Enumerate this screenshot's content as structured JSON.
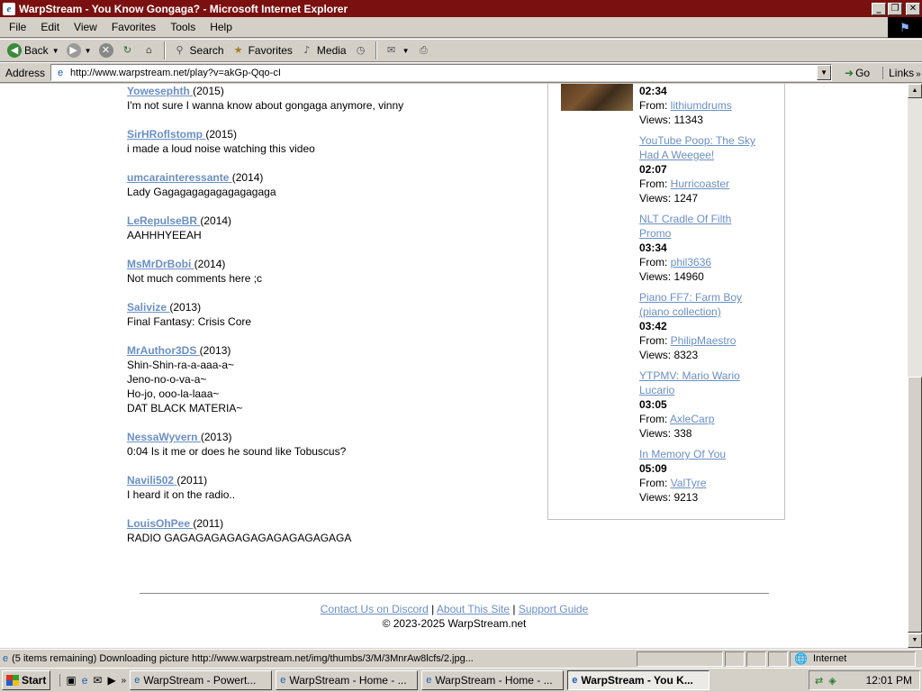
{
  "window": {
    "title": "WarpStream - You Know Gongaga? - Microsoft Internet Explorer",
    "buttons": {
      "minimize": "_",
      "maximize": "❐",
      "close": "✕"
    }
  },
  "menu": [
    "File",
    "Edit",
    "View",
    "Favorites",
    "Tools",
    "Help"
  ],
  "toolbar": {
    "back": "Back",
    "search": "Search",
    "favorites": "Favorites",
    "media": "Media"
  },
  "address": {
    "label": "Address",
    "url": "http://www.warpstream.net/play?v=akGp-Qqo-cI",
    "go": "Go",
    "links": "Links"
  },
  "comments": [
    {
      "author": "Yowesephth ",
      "year": "(2015)",
      "lines": [
        "I'm not sure I wanna know about gongaga anymore, vinny"
      ]
    },
    {
      "author": "SirHRoflstomp ",
      "year": "(2015)",
      "lines": [
        "i made a loud noise watching this video"
      ]
    },
    {
      "author": "umcarainteressante ",
      "year": "(2014)",
      "lines": [
        "Lady Gagagagagagagagagaga"
      ]
    },
    {
      "author": "LeRepulseBR ",
      "year": "(2014)",
      "lines": [
        "AAHHHYEEAH"
      ]
    },
    {
      "author": "MsMrDrBobi ",
      "year": "(2014)",
      "lines": [
        "Not much comments here ;c"
      ]
    },
    {
      "author": "Salivize ",
      "year": "(2013)",
      "lines": [
        "Final Fantasy: Crisis Core"
      ]
    },
    {
      "author": "MrAuthor3DS ",
      "year": "(2013)",
      "lines": [
        "Shin-Shin-ra-a-aaa-a~",
        "Jeno-no-o-va-a~",
        "Ho-jo, ooo-la-laaa~",
        "DAT BLACK MATERIA~"
      ]
    },
    {
      "author": "NessaWyvern ",
      "year": "(2013)",
      "lines": [
        "0:04 Is it me or does he sound like Tobuscus?"
      ]
    },
    {
      "author": "Navili502 ",
      "year": "(2011)",
      "lines": [
        "I heard it on the radio.."
      ]
    },
    {
      "author": "LouisOhPee ",
      "year": "(2011)",
      "lines": [
        "RADIO GAGAGAGAGAGAGAGAGAGAGAGA"
      ]
    }
  ],
  "related": [
    {
      "title_lines": [],
      "duration": "02:34",
      "from_label": "From: ",
      "from": "lithiumdrums",
      "views": "Views: 11343"
    },
    {
      "title_lines": [
        "YouTube Poop: The Sky",
        "Had A Weegee!"
      ],
      "duration": "02:07",
      "from_label": "From: ",
      "from": "Hurricoaster",
      "views": "Views: 1247"
    },
    {
      "title_lines": [
        "NLT Cradle Of Filth",
        "Promo"
      ],
      "duration": "03:34",
      "from_label": "From: ",
      "from": "phil3636",
      "views": "Views: 14960"
    },
    {
      "title_lines": [
        "Piano FF7: Farm Boy",
        "(piano collection)"
      ],
      "duration": "03:42",
      "from_label": "From: ",
      "from": "PhilipMaestro",
      "views": "Views: 8323"
    },
    {
      "title_lines": [
        "YTPMV: Mario Wario",
        "Lucario"
      ],
      "duration": "03:05",
      "from_label": "From: ",
      "from": "AxleCarp",
      "views": "Views: 338"
    },
    {
      "title_lines": [
        "In Memory Of You"
      ],
      "duration": "05:09",
      "from_label": "From: ",
      "from": "ValTyre",
      "views": "Views: 9213"
    }
  ],
  "footer": {
    "links": [
      "Contact Us on Discord",
      "About This Site",
      "Support Guide"
    ],
    "separator": " | ",
    "copyright": "© 2023-2025 WarpStream.net"
  },
  "status": {
    "text": "(5 items remaining) Downloading picture http://www.warpstream.net/img/thumbs/3/M/3MnrAw8lcfs/2.jpg...",
    "zone": "Internet",
    "progress": 0
  },
  "taskbar": {
    "start": "Start",
    "tasks": [
      {
        "label": "WarpStream - Powert...",
        "active": false
      },
      {
        "label": "WarpStream - Home - ...",
        "active": false
      },
      {
        "label": "WarpStream - Home - ...",
        "active": false
      },
      {
        "label": "WarpStream - You K...",
        "active": true
      }
    ],
    "clock": "12:01 PM"
  },
  "icons": {
    "app": "ie-logo-icon",
    "back": "back-arrow-icon",
    "forward": "forward-arrow-icon",
    "stop": "stop-icon",
    "refresh": "refresh-icon",
    "home": "home-icon",
    "search": "search-icon",
    "favorites": "favorites-icon",
    "media": "media-icon",
    "history": "history-icon",
    "mail": "mail-icon",
    "print": "print-icon"
  }
}
